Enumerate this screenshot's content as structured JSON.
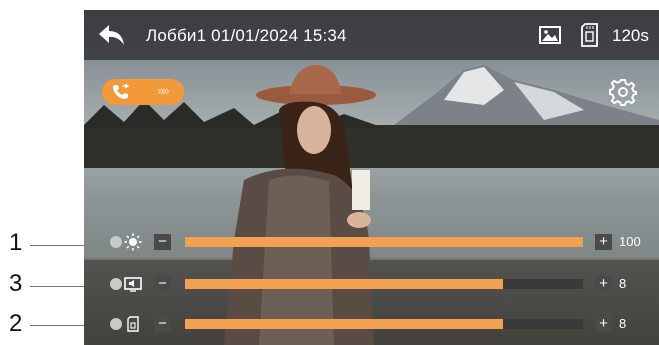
{
  "topbar": {
    "title": "Лобби1 01/01/2024 15:34",
    "timer": "120s",
    "icons": [
      "back-arrow-icon",
      "photo-icon",
      "sd-card-icon"
    ]
  },
  "call_pill": {
    "icon": "phone-icon",
    "arrows": "»»"
  },
  "settings_icon": "gear-icon",
  "sliders": [
    {
      "icon": "brightness-icon",
      "minus": "−",
      "plus": "+",
      "value": "100",
      "level": 1.0
    },
    {
      "icon": "volume-screen-icon",
      "minus": "−",
      "plus": "+",
      "value": "8",
      "level": 0.8
    },
    {
      "icon": "sd-small-icon",
      "minus": "−",
      "plus": "+",
      "value": "8",
      "level": 0.8
    }
  ],
  "callouts": [
    "1",
    "3",
    "2"
  ],
  "colors": {
    "accent": "#f29a3a",
    "slider_fill": "#f2a052",
    "topbar": "#2d2d30",
    "track": "#3a3a3a"
  }
}
